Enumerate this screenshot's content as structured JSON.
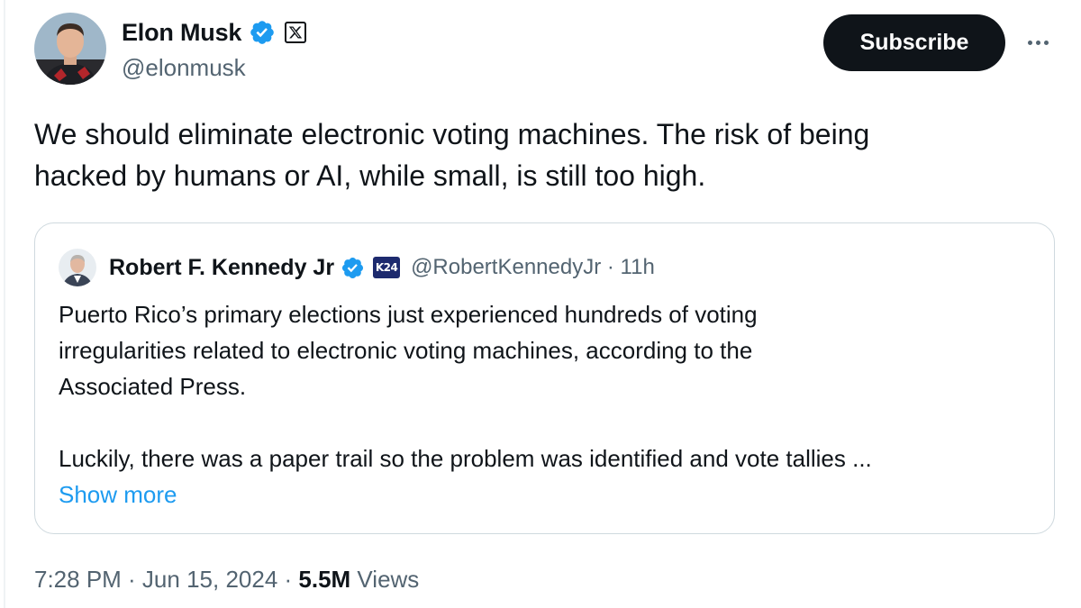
{
  "author": {
    "display_name": "Elon Musk",
    "handle": "@elonmusk",
    "avatar": "profile-photo",
    "verified_icon": "verified-badge-icon",
    "affiliate_icon": "x-logo-icon"
  },
  "actions": {
    "subscribe_label": "Subscribe",
    "more_icon": "more-horizontal-icon"
  },
  "tweet": {
    "text_line1": "We should eliminate electronic voting machines. The risk of being",
    "text_line2": "hacked by humans or AI, while small, is still too high."
  },
  "quote": {
    "display_name": "Robert F. Kennedy Jr",
    "handle_time": "@RobertKennedyJr · 11h",
    "badge_text": "K24",
    "lines": [
      "Puerto Rico’s primary elections just experienced hundreds of voting",
      "irregularities related to electronic voting machines, according to the",
      "Associated Press."
    ],
    "line_truncated": "Luckily, there was a paper trail so the problem was identified and vote tallies ...",
    "show_more": "Show more"
  },
  "meta": {
    "timestamp": "7:28 PM · Jun 15, 2024 · ",
    "views_count": "5.5M",
    "views_label": " Views"
  },
  "colors": {
    "text": "#0f1419",
    "secondary": "#536471",
    "link": "#1d9bf0",
    "border": "#cfd9de",
    "verified": "#1d9bf0"
  }
}
